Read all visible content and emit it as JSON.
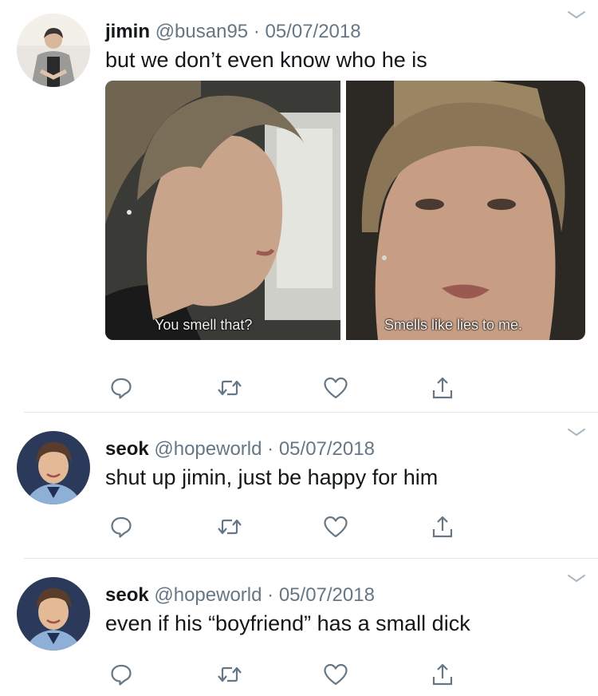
{
  "tweets": [
    {
      "name": "jimin",
      "handle": "@busan95",
      "separator": "·",
      "date": "05/07/2018",
      "text": "but we don’t even know who he is",
      "media": {
        "left_caption": "You smell that?",
        "right_caption": "Smells like lies to me."
      }
    },
    {
      "name": "seok",
      "handle": "@hopeworld",
      "separator": "·",
      "date": "05/07/2018",
      "text": "shut up jimin, just be happy for him"
    },
    {
      "name": "seok",
      "handle": "@hopeworld",
      "separator": "·",
      "date": "05/07/2018",
      "text": "even if his “boyfriend” has a small dick"
    }
  ],
  "icons": {
    "reply": "reply-icon",
    "retweet": "retweet-icon",
    "like": "heart-icon",
    "share": "share-icon",
    "caret": "chevron-down-icon"
  },
  "colors": {
    "icon": "#657786",
    "name": "#14171a",
    "meta": "#657786",
    "divider": "#e1e8ed"
  }
}
